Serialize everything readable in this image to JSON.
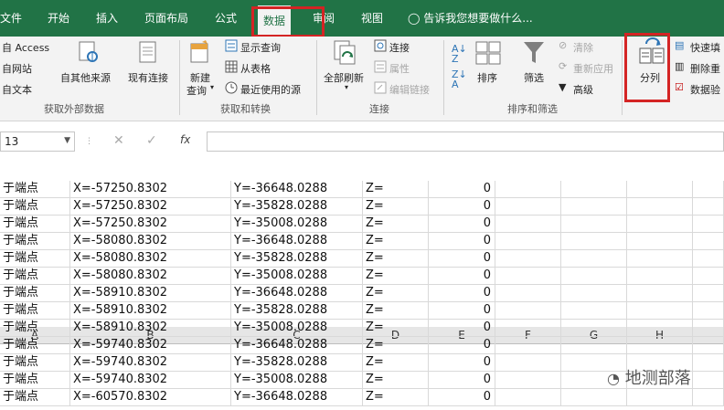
{
  "tabs": [
    "文件",
    "开始",
    "插入",
    "页面布局",
    "公式",
    "数据",
    "审阅",
    "视图"
  ],
  "tell_me": "告诉我您想要做什么...",
  "ribbon": {
    "get_external": {
      "access": "自 Access",
      "web": "自网站",
      "text": "自文本",
      "other": "自其他来源",
      "existing": "现有连接",
      "label": "获取外部数据"
    },
    "get_transform": {
      "new_query_1": "新建",
      "new_query_2": "查询",
      "show_queries": "显示查询",
      "from_table": "从表格",
      "recent_sources": "最近使用的源",
      "label": "获取和转换"
    },
    "connections": {
      "refresh_all": "全部刷新",
      "connections": "连接",
      "properties": "属性",
      "edit_links": "编辑链接",
      "label": "连接"
    },
    "sort_filter": {
      "sort": "排序",
      "filter": "筛选",
      "clear": "清除",
      "reapply": "重新应用",
      "advanced": "高级",
      "label": "排序和筛选"
    },
    "data_tools": {
      "split": "分列",
      "flash_fill": "快速填",
      "remove_dup": "删除重",
      "validate": "数据验"
    }
  },
  "formula_bar": {
    "name_box": "13",
    "fx": "fx",
    "value": ""
  },
  "columns": [
    "A",
    "B",
    "C",
    "D",
    "E",
    "F",
    "G",
    "H"
  ],
  "rows": [
    [
      "于端点",
      "X=-57250.8302",
      "Y=-36648.0288",
      "Z=",
      "0"
    ],
    [
      "于端点",
      "X=-57250.8302",
      "Y=-35828.0288",
      "Z=",
      "0"
    ],
    [
      "于端点",
      "X=-57250.8302",
      "Y=-35008.0288",
      "Z=",
      "0"
    ],
    [
      "于端点",
      "X=-58080.8302",
      "Y=-36648.0288",
      "Z=",
      "0"
    ],
    [
      "于端点",
      "X=-58080.8302",
      "Y=-35828.0288",
      "Z=",
      "0"
    ],
    [
      "于端点",
      "X=-58080.8302",
      "Y=-35008.0288",
      "Z=",
      "0"
    ],
    [
      "于端点",
      "X=-58910.8302",
      "Y=-36648.0288",
      "Z=",
      "0"
    ],
    [
      "于端点",
      "X=-58910.8302",
      "Y=-35828.0288",
      "Z=",
      "0"
    ],
    [
      "于端点",
      "X=-58910.8302",
      "Y=-35008.0288",
      "Z=",
      "0"
    ],
    [
      "于端点",
      "X=-59740.8302",
      "Y=-36648.0288",
      "Z=",
      "0"
    ],
    [
      "于端点",
      "X=-59740.8302",
      "Y=-35828.0288",
      "Z=",
      "0"
    ],
    [
      "于端点",
      "X=-59740.8302",
      "Y=-35008.0288",
      "Z=",
      "0"
    ],
    [
      "于端点",
      "X=-60570.8302",
      "Y=-36648.0288",
      "Z=",
      "0"
    ]
  ],
  "watermark": "地测部落",
  "colors": {
    "excel_green": "#217346",
    "highlight_red": "#d42424"
  }
}
